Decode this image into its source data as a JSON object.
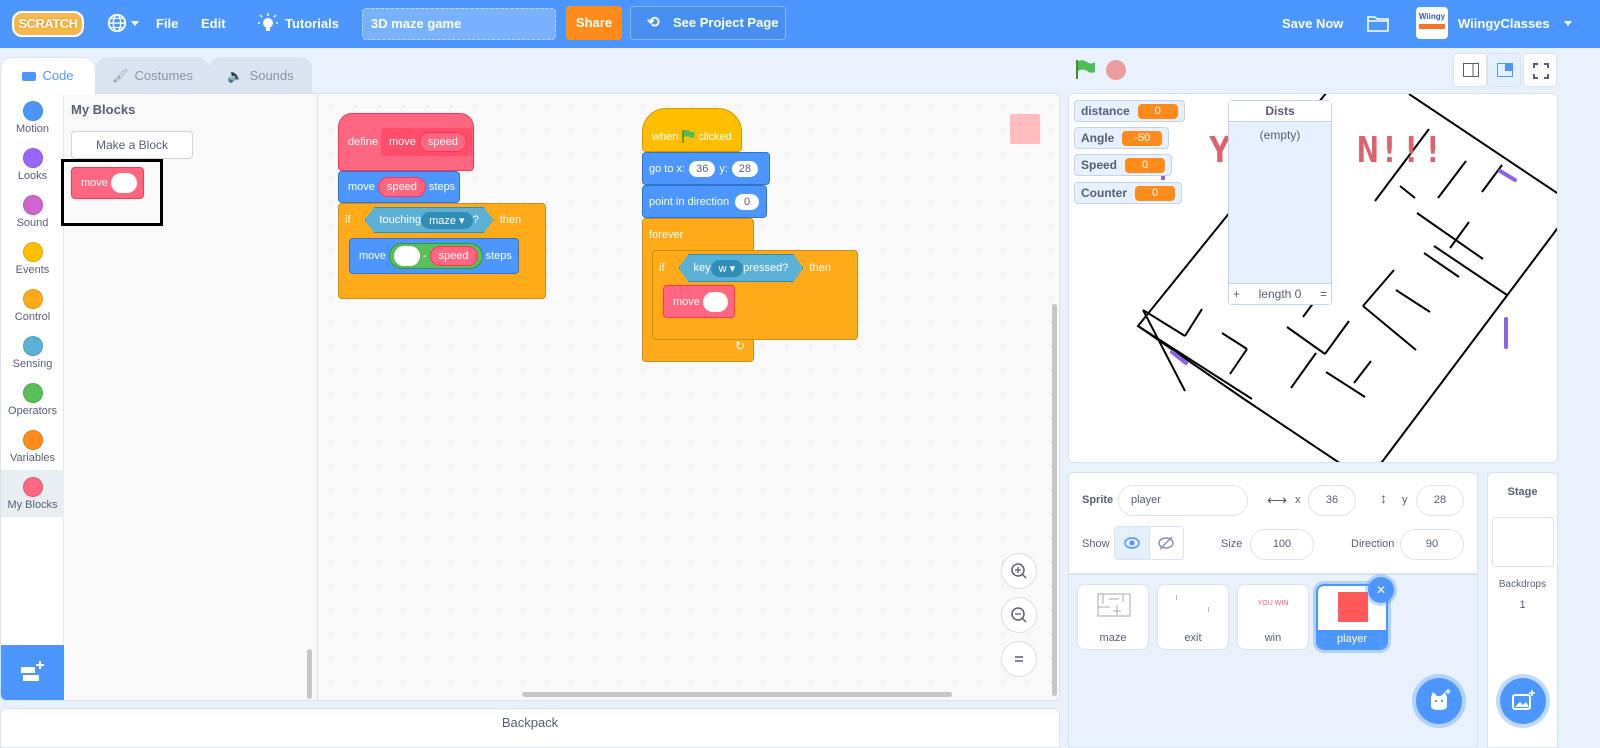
{
  "menubar": {
    "logo": "SCRATCH",
    "file": "File",
    "edit": "Edit",
    "tutorials": "Tutorials",
    "project_title": "3D maze game",
    "share": "Share",
    "see_project_page": "See Project Page",
    "save_now": "Save Now",
    "username": "WiingyClasses",
    "avatar_text": "Wiingy"
  },
  "tabs": [
    {
      "label": "Code",
      "active": true
    },
    {
      "label": "Costumes",
      "active": false
    },
    {
      "label": "Sounds",
      "active": false
    }
  ],
  "categories": [
    {
      "label": "Motion",
      "color": "#4c97ff"
    },
    {
      "label": "Looks",
      "color": "#9966ff"
    },
    {
      "label": "Sound",
      "color": "#cf63cf"
    },
    {
      "label": "Events",
      "color": "#ffbf00"
    },
    {
      "label": "Control",
      "color": "#ffab19"
    },
    {
      "label": "Sensing",
      "color": "#5cb1d6"
    },
    {
      "label": "Operators",
      "color": "#59c059"
    },
    {
      "label": "Variables",
      "color": "#ff8c1a"
    },
    {
      "label": "My Blocks",
      "color": "#ff6680",
      "selected": true
    }
  ],
  "flyout": {
    "title": "My Blocks",
    "make_block": "Make a Block",
    "custom_block": "move"
  },
  "scripts": {
    "define": {
      "define": "define",
      "name": "move",
      "param": "speed",
      "move": "move",
      "steps": "steps",
      "if": "if",
      "touching": "touching",
      "touch_target": "maze",
      "question": "?",
      "then": "then",
      "minus": "-"
    },
    "main": {
      "when": "when",
      "clicked": "clicked",
      "goto_x": "go to x:",
      "x": "36",
      "y_label": "y:",
      "y": "28",
      "point_dir": "point in direction",
      "direction": "0",
      "forever": "forever",
      "if": "if",
      "key": "key",
      "key_value": "w",
      "pressed": "pressed?",
      "then": "then",
      "move": "move"
    }
  },
  "backpack": "Backpack",
  "stage": {
    "monitors": [
      {
        "label": "distance",
        "value": "0"
      },
      {
        "label": "Angle",
        "value": "-50"
      },
      {
        "label": "Speed",
        "value": "0"
      },
      {
        "label": "Counter",
        "value": "0"
      }
    ],
    "list": {
      "title": "Dists",
      "empty": "(empty)",
      "add": "+",
      "length": "length 0",
      "resize": "="
    }
  },
  "sprite_info": {
    "sprite_label": "Sprite",
    "sprite_name": "player",
    "x_label": "x",
    "x": "36",
    "y_label": "y",
    "y": "28",
    "show_label": "Show",
    "size_label": "Size",
    "size": "100",
    "direction_label": "Direction",
    "direction": "90"
  },
  "sprites": [
    {
      "name": "maze"
    },
    {
      "name": "exit"
    },
    {
      "name": "win",
      "thumb_text": "YOU WIN"
    },
    {
      "name": "player",
      "selected": true
    }
  ],
  "stage_pane": {
    "title": "Stage",
    "backdrops_label": "Backdrops",
    "backdrops_count": "1"
  }
}
